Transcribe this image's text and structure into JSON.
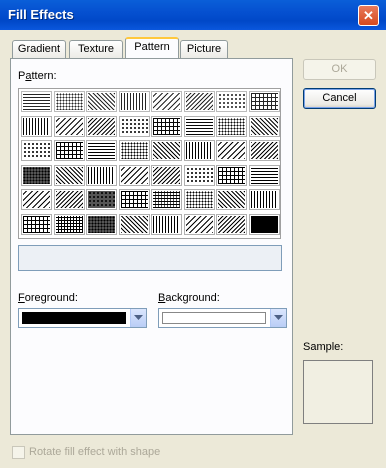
{
  "window": {
    "title": "Fill Effects",
    "close_glyph": "✕"
  },
  "tabs": [
    {
      "label": "Gradient",
      "active": false
    },
    {
      "label": "Texture",
      "active": false
    },
    {
      "label": "Pattern",
      "active": true
    },
    {
      "label": "Picture",
      "active": false
    }
  ],
  "pattern_section": {
    "label": "Pattern:"
  },
  "foreground": {
    "label": "Foreground:",
    "color": "#000000"
  },
  "background": {
    "label": "Background:",
    "color": "#ffffff"
  },
  "buttons": {
    "ok": "OK",
    "cancel": "Cancel"
  },
  "sample": {
    "label": "Sample:"
  },
  "rotate_checkbox": {
    "label": "Rotate fill effect with shape",
    "checked": false,
    "enabled": false
  }
}
